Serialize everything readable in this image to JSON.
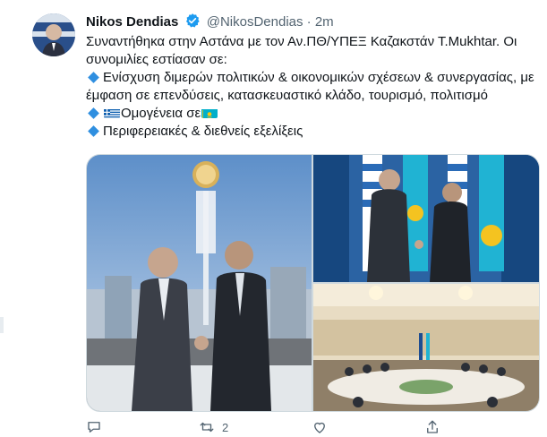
{
  "tweet": {
    "author_name": "Nikos Dendias",
    "author_handle": "@NikosDendias",
    "separator": "·",
    "timestamp": "2m",
    "verified": true,
    "text_line1": "Συναντήθηκα στην Αστάνα με τον Αν.ΠΘ/ΥΠΕΞ Καζακστάν Τ.Mukhtar. Οι συνομιλίες εστίασαν σε:",
    "bullet1": "Ενίσχυση διμερών πολιτικών & οικονομικών σχέσεων & συνεργασίας, με έμφαση σε επενδύσεις, κατασκευαστικό κλάδο, τουρισμό, πολιτισμό",
    "bullet2_prefix": "Ομογένεια σε",
    "bullet3": "Περιφερειακές & διεθνείς εξελίξεις",
    "retweet_count": "2"
  },
  "icons": {
    "verified": "verified-badge-icon",
    "bullet": "blue-diamond-icon",
    "flag_greece": "greece-flag-icon",
    "flag_kazakhstan": "kazakhstan-flag-icon",
    "reply": "reply-icon",
    "retweet": "retweet-icon",
    "like": "like-icon",
    "share": "share-icon"
  },
  "colors": {
    "accent": "#1d9bf0",
    "text": "#0f1419",
    "muted": "#536471",
    "bullet": "#2f8fe0",
    "kazakh_blue": "#00afca",
    "greek_blue": "#0d5eaf"
  }
}
